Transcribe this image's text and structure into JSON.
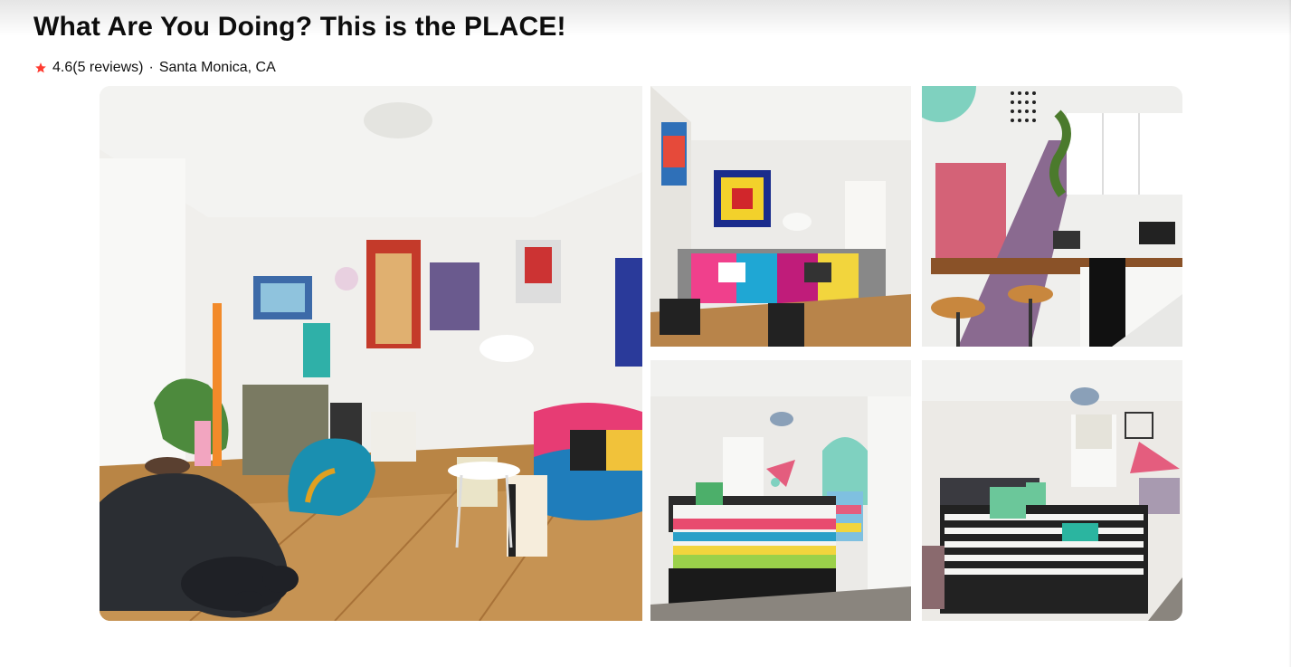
{
  "listing": {
    "title": "What Are You Doing? This is the PLACE!",
    "rating": "4.6",
    "reviews": "(5 reviews)",
    "separator": "·",
    "location": "Santa Monica, CA"
  },
  "colors": {
    "star": "#ff3b30",
    "text": "#111111"
  },
  "icons": {
    "star": "star-icon"
  },
  "gallery": {
    "photos": [
      {
        "name": "living-room-photo"
      },
      {
        "name": "sofa-room-photo"
      },
      {
        "name": "kitchen-photo"
      },
      {
        "name": "bedroom-colorful-photo"
      },
      {
        "name": "bedroom-striped-photo"
      }
    ]
  }
}
